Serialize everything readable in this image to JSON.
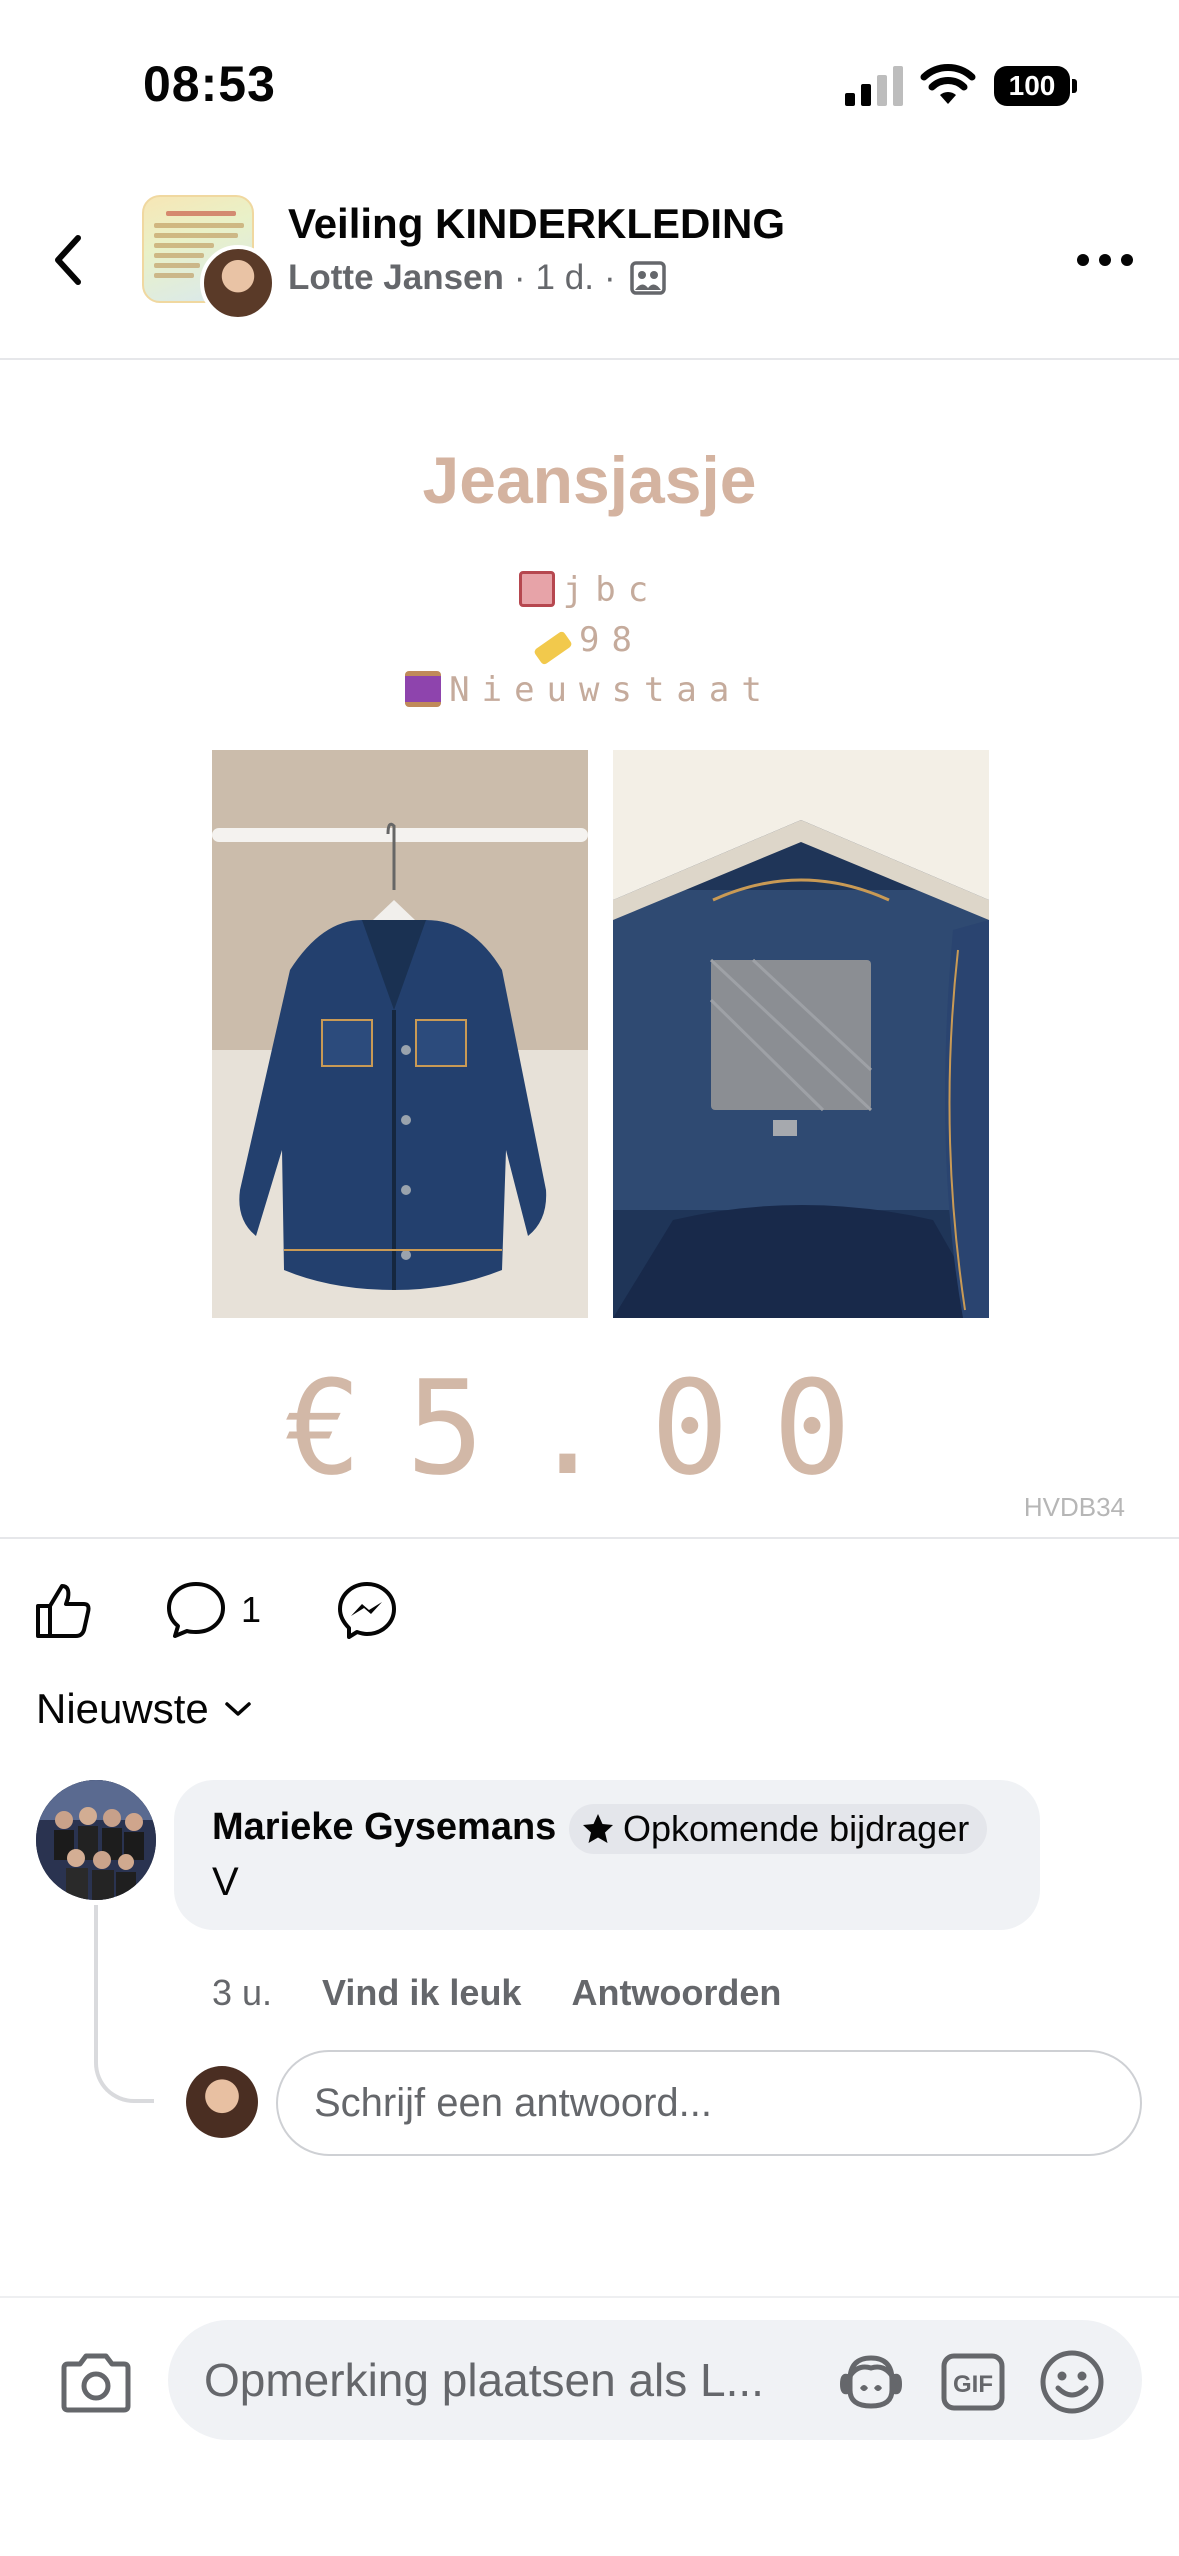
{
  "status_bar": {
    "time": "08:53",
    "battery": "100"
  },
  "header": {
    "group_name": "Veiling KINDERKLEDING",
    "author": "Lotte Jansen",
    "time": "1 d."
  },
  "post_image": {
    "title": "Jeansjasje",
    "brand": "jbc",
    "size": "98",
    "condition": "Nieuwstaat",
    "price": "€5.00",
    "watermark": "HVDB34"
  },
  "actions": {
    "comment_count": "1"
  },
  "sort": {
    "label": "Nieuwste"
  },
  "comment": {
    "name": "Marieke Gysemans",
    "badge": "Opkomende bijdrager",
    "text": "V",
    "time": "3 u.",
    "like": "Vind ik leuk",
    "reply": "Antwoorden"
  },
  "reply_input": {
    "placeholder": "Schrijf een antwoord..."
  },
  "composer": {
    "placeholder": "Opmerking plaatsen als L..."
  },
  "icons": [
    "signal-icon",
    "wifi-icon",
    "battery-icon",
    "back-icon",
    "more-icon",
    "group-icon",
    "like-icon",
    "comment-icon",
    "messenger-icon",
    "chevron-down-icon",
    "star-icon",
    "camera-icon",
    "avatar-sticker-icon",
    "gif-icon",
    "emoji-icon"
  ]
}
